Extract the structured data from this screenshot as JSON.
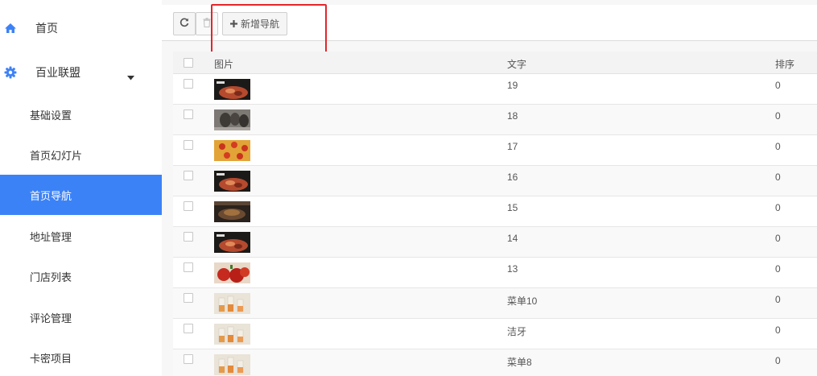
{
  "sidebar": {
    "home_label": "首页",
    "group_label": "百业联盟",
    "items": [
      {
        "label": "基础设置",
        "active": false
      },
      {
        "label": "首页幻灯片",
        "active": false
      },
      {
        "label": "首页导航",
        "active": true
      },
      {
        "label": "地址管理",
        "active": false
      },
      {
        "label": "门店列表",
        "active": false
      },
      {
        "label": "评论管理",
        "active": false
      },
      {
        "label": "卡密项目",
        "active": false
      }
    ]
  },
  "toolbar": {
    "refresh_icon": "refresh-icon",
    "delete_icon": "trash-icon",
    "add_label": "新增导航"
  },
  "table": {
    "columns": {
      "image": "图片",
      "text": "文字",
      "sort": "排序"
    },
    "rows": [
      {
        "text": "19",
        "sort": "0",
        "thumb": "dish-dark"
      },
      {
        "text": "18",
        "sort": "0",
        "thumb": "dish-grey"
      },
      {
        "text": "17",
        "sort": "0",
        "thumb": "pizza"
      },
      {
        "text": "16",
        "sort": "0",
        "thumb": "dish-dark"
      },
      {
        "text": "15",
        "sort": "0",
        "thumb": "dish-brown"
      },
      {
        "text": "14",
        "sort": "0",
        "thumb": "dish-dark"
      },
      {
        "text": "13",
        "sort": "0",
        "thumb": "tomato"
      },
      {
        "text": "菜单10",
        "sort": "0",
        "thumb": "drinks"
      },
      {
        "text": "洁牙",
        "sort": "0",
        "thumb": "drinks"
      },
      {
        "text": "菜单8",
        "sort": "0",
        "thumb": "drinks"
      }
    ]
  },
  "colors": {
    "active_nav": "#3c82f7",
    "highlight_box": "#e3262b",
    "icon_blue": "#3c82f7"
  }
}
